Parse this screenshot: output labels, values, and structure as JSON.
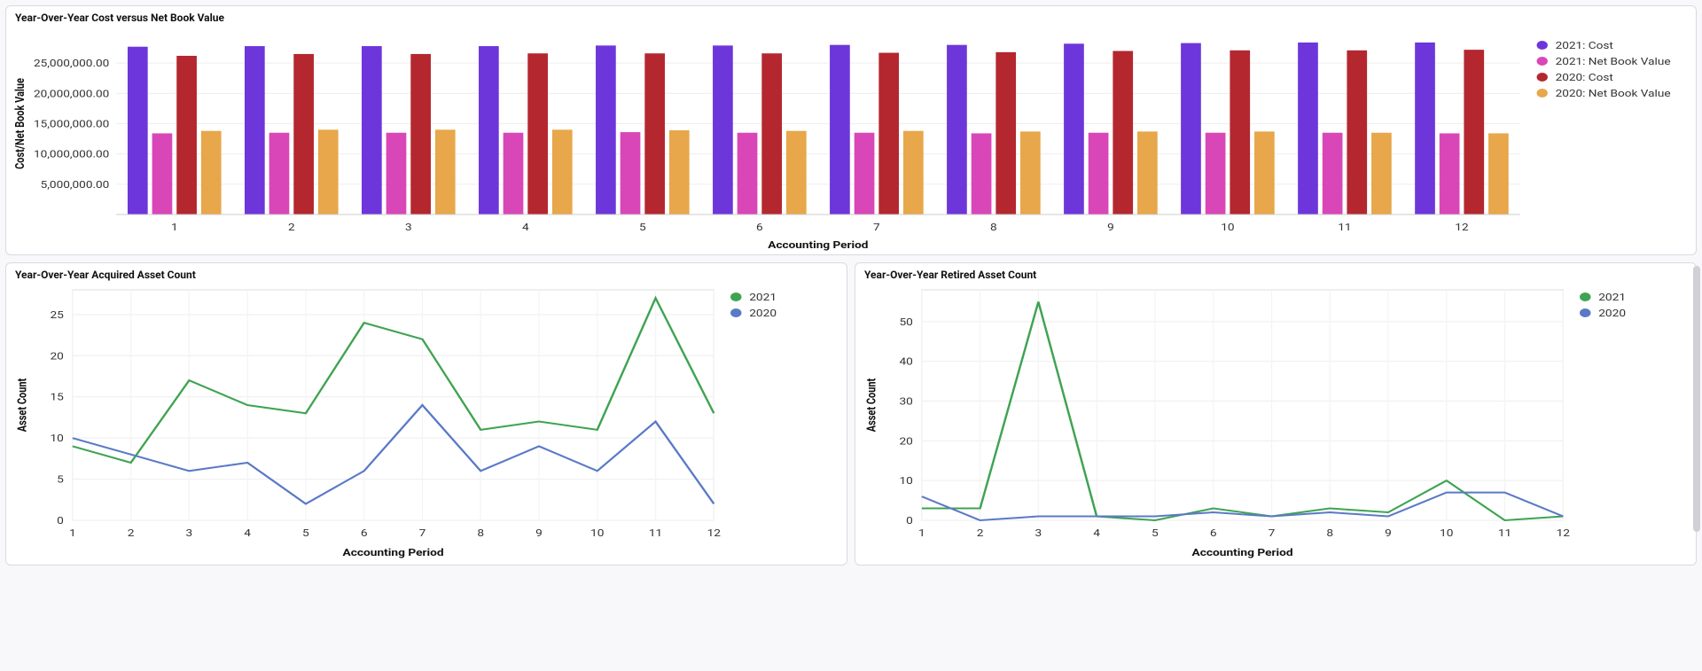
{
  "charts": {
    "top": {
      "title": "Year-Over-Year Cost versus Net Book Value",
      "xlabel": "Accounting Period",
      "ylabel": "Cost/Net Book Value"
    },
    "bottomLeft": {
      "title": "Year-Over-Year Acquired Asset Count",
      "xlabel": "Accounting Period",
      "ylabel": "Asset Count"
    },
    "bottomRight": {
      "title": "Year-Over-Year Retired Asset Count",
      "xlabel": "Accounting Period",
      "ylabel": "Asset Count"
    }
  },
  "colors": {
    "cost2021": "#6d36db",
    "nbv2021": "#d946b8",
    "cost2020": "#b4272f",
    "nbv2020": "#e7a74a",
    "line2021": "#3fa352",
    "line2020": "#5a79c7"
  },
  "legendTop": [
    {
      "label": "2021: Cost",
      "color": "cost2021"
    },
    {
      "label": "2021: Net Book Value",
      "color": "nbv2021"
    },
    {
      "label": "2020: Cost",
      "color": "cost2020"
    },
    {
      "label": "2020: Net Book Value",
      "color": "nbv2020"
    }
  ],
  "legendLine": [
    {
      "label": "2021",
      "color": "line2021"
    },
    {
      "label": "2020",
      "color": "line2020"
    }
  ],
  "chart_data": [
    {
      "type": "bar",
      "title": "Year-Over-Year Cost versus Net Book Value",
      "xlabel": "Accounting Period",
      "ylabel": "Cost/Net Book Value",
      "categories": [
        "1",
        "2",
        "3",
        "4",
        "5",
        "6",
        "7",
        "8",
        "9",
        "10",
        "11",
        "12"
      ],
      "series": [
        {
          "name": "2021: Cost",
          "values": [
            27700000,
            27800000,
            27800000,
            27800000,
            27900000,
            27900000,
            28000000,
            28000000,
            28200000,
            28300000,
            28400000,
            28400000
          ]
        },
        {
          "name": "2021: Net Book Value",
          "values": [
            13400000,
            13500000,
            13500000,
            13500000,
            13600000,
            13500000,
            13500000,
            13400000,
            13500000,
            13500000,
            13500000,
            13400000
          ]
        },
        {
          "name": "2020: Cost",
          "values": [
            26200000,
            26500000,
            26500000,
            26600000,
            26600000,
            26600000,
            26700000,
            26800000,
            27000000,
            27100000,
            27100000,
            27200000
          ]
        },
        {
          "name": "2020: Net Book Value",
          "values": [
            13800000,
            14000000,
            14000000,
            14000000,
            13900000,
            13800000,
            13800000,
            13700000,
            13700000,
            13700000,
            13500000,
            13400000
          ]
        }
      ],
      "ylim": [
        0,
        30000000
      ],
      "yticks": [
        5000000,
        10000000,
        15000000,
        20000000,
        25000000
      ],
      "ytick_labels": [
        "5,000,000.00",
        "10,000,000.00",
        "15,000,000.00",
        "20,000,000.00",
        "25,000,000.00"
      ]
    },
    {
      "type": "line",
      "title": "Year-Over-Year Acquired Asset Count",
      "xlabel": "Accounting Period",
      "ylabel": "Asset Count",
      "x": [
        "1",
        "2",
        "3",
        "4",
        "5",
        "6",
        "7",
        "8",
        "9",
        "10",
        "11",
        "12"
      ],
      "series": [
        {
          "name": "2021",
          "values": [
            9,
            7,
            17,
            14,
            13,
            24,
            22,
            11,
            12,
            11,
            27,
            13
          ]
        },
        {
          "name": "2020",
          "values": [
            10,
            8,
            6,
            7,
            2,
            6,
            14,
            6,
            9,
            6,
            12,
            2
          ]
        }
      ],
      "ylim": [
        0,
        28
      ],
      "yticks": [
        0,
        5,
        10,
        15,
        20,
        25
      ]
    },
    {
      "type": "line",
      "title": "Year-Over-Year Retired Asset Count",
      "xlabel": "Accounting Period",
      "ylabel": "Asset Count",
      "x": [
        "1",
        "2",
        "3",
        "4",
        "5",
        "6",
        "7",
        "8",
        "9",
        "10",
        "11",
        "12"
      ],
      "series": [
        {
          "name": "2021",
          "values": [
            3,
            3,
            55,
            1,
            0,
            3,
            1,
            3,
            2,
            10,
            0,
            1
          ]
        },
        {
          "name": "2020",
          "values": [
            6,
            0,
            1,
            1,
            1,
            2,
            1,
            2,
            1,
            7,
            7,
            1
          ]
        }
      ],
      "ylim": [
        0,
        58
      ],
      "yticks": [
        0,
        10,
        20,
        30,
        40,
        50
      ]
    }
  ]
}
